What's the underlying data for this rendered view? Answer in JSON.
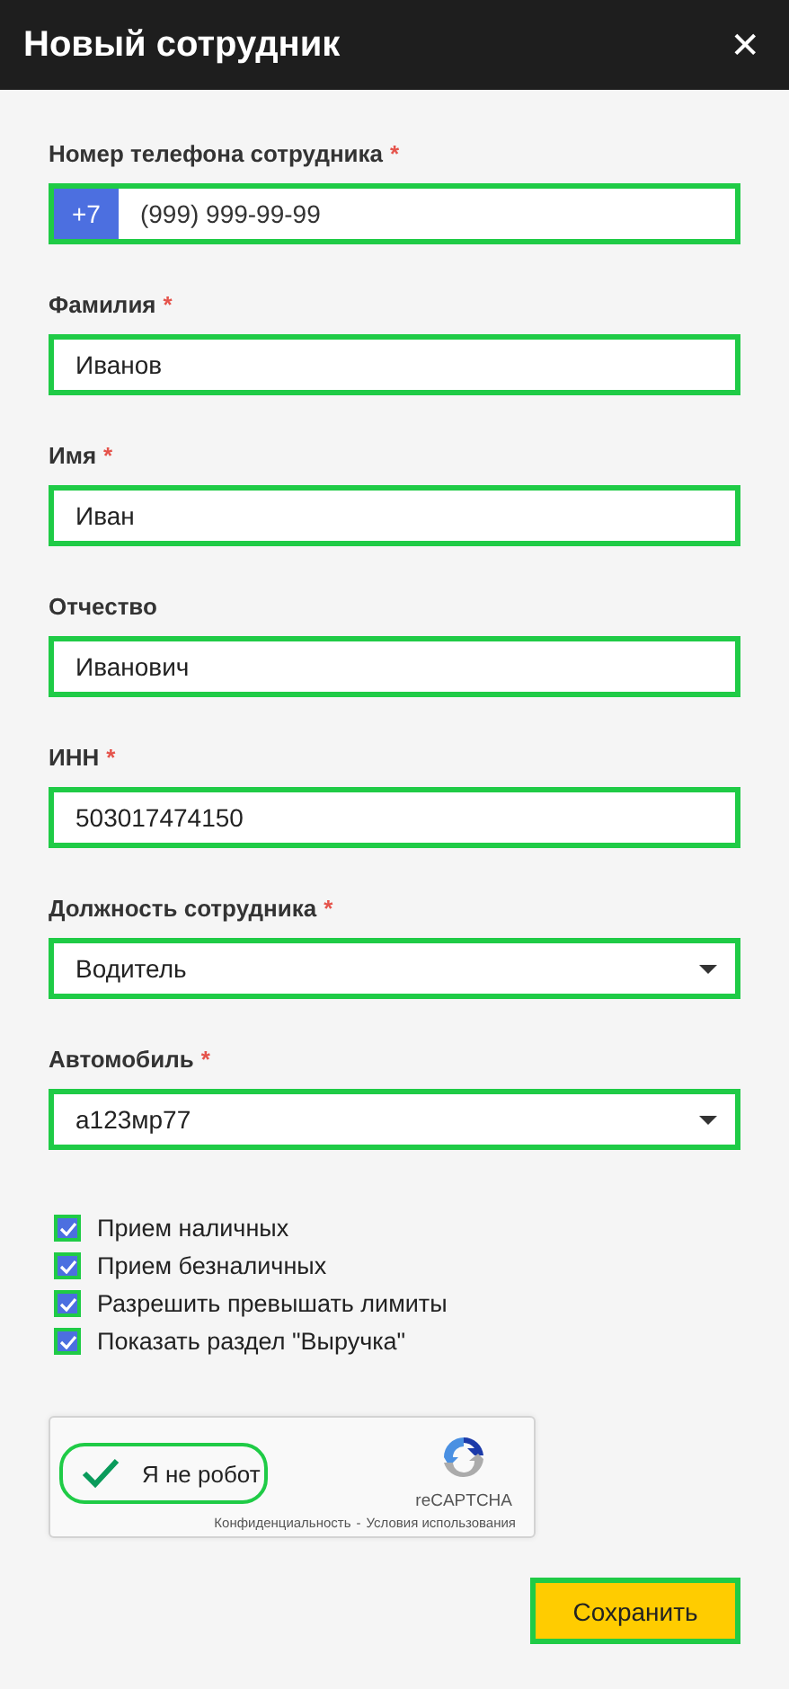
{
  "window": {
    "title": "Новый сотрудник",
    "close": "✕"
  },
  "fields": [
    {
      "kind": "phone",
      "label": "Номер телефона сотрудника",
      "required_mark": "*",
      "prefix": "+7",
      "placeholder": "(999) 999-99-99"
    },
    {
      "kind": "text",
      "label": "Фамилия",
      "required_mark": "*",
      "value": "Иванов"
    },
    {
      "kind": "text",
      "label": "Имя",
      "required_mark": "*",
      "value": "Иван"
    },
    {
      "kind": "text",
      "label": "Отчество",
      "value": "Иванович"
    },
    {
      "kind": "text",
      "label": "ИНН",
      "required_mark": "*",
      "value": "503017474150"
    },
    {
      "kind": "select",
      "label": "Должность сотрудника",
      "required_mark": "*",
      "value": "Водитель"
    },
    {
      "kind": "select",
      "label": "Автомобиль",
      "required_mark": "*",
      "value": "а123мр77"
    }
  ],
  "checkboxes": [
    {
      "label": "Прием наличных",
      "checked": true
    },
    {
      "label": "Прием безналичных",
      "checked": true
    },
    {
      "label": "Разрешить превышать лимиты",
      "checked": true
    },
    {
      "label": "Показать раздел \"Выручка\"",
      "checked": true
    }
  ],
  "captcha": {
    "label": "Я не робот",
    "checked": true,
    "brand": "reCAPTCHA",
    "privacy": "Конфиденциальность",
    "separator": "-",
    "terms": "Условия использования"
  },
  "save_button": "Сохранить"
}
